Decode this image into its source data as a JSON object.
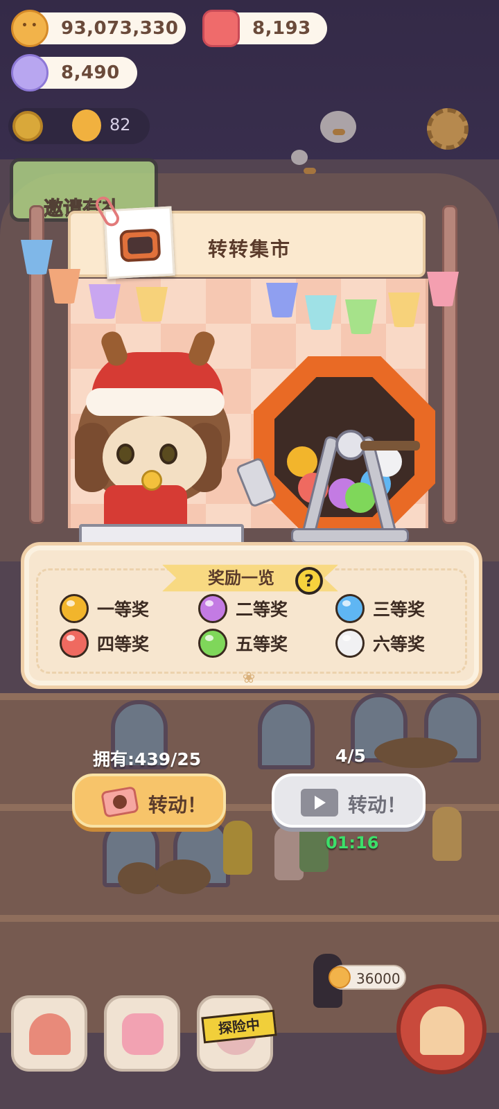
{
  "resources": {
    "coins": "93,073,330",
    "candles": "8,193",
    "gems": "8,490",
    "level_count": "82"
  },
  "invite_banner": {
    "label": "邀请有礼"
  },
  "stall": {
    "title": "转转集市"
  },
  "rewards": {
    "title": "奖励一览",
    "help_icon": "?",
    "prizes": [
      {
        "label": "一等奖",
        "color": "#f2b52c"
      },
      {
        "label": "二等奖",
        "color": "#c37be3"
      },
      {
        "label": "三等奖",
        "color": "#5fb6f3"
      },
      {
        "label": "四等奖",
        "color": "#ef6a60"
      },
      {
        "label": "五等奖",
        "color": "#7fd75a"
      },
      {
        "label": "六等奖",
        "color": "#f1f1f3"
      }
    ]
  },
  "controls": {
    "owned_text": "拥有:439/25",
    "video_count": "4/5",
    "spin_label": "转动！",
    "video_spin_label": "转动！",
    "timer": "01:16"
  },
  "bottom": {
    "cost": "36000",
    "explore_tag": "探险中"
  },
  "colors": {
    "accent": "#f7c46a",
    "timer": "#3ce06a",
    "machine": "#e96a25"
  }
}
